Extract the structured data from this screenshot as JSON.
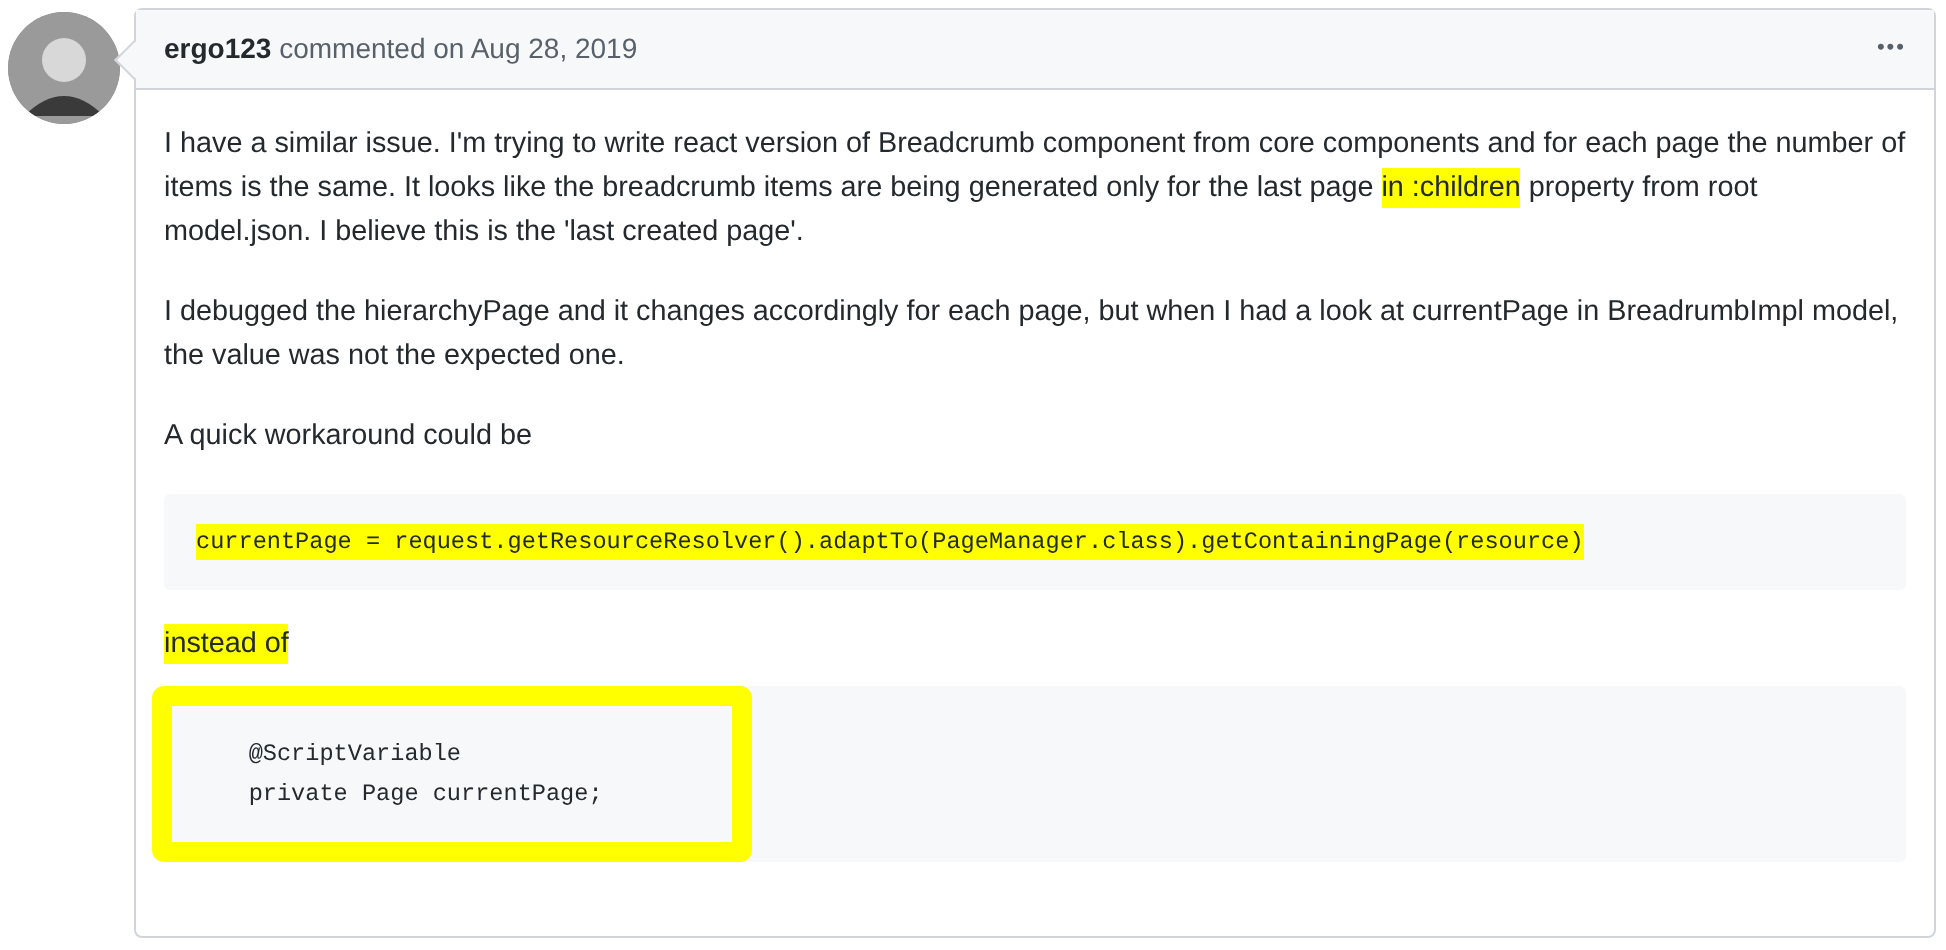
{
  "comment": {
    "author": "ergo123",
    "meta": "commented on Aug 28, 2019",
    "menu": "•••",
    "blocks": [
      {
        "kind": "paragraph",
        "segments": [
          {
            "text": "I have a similar issue. I'm trying to write react version of Breadcrumb component from core components and for each page the number of items is the same. It looks like the breadcrumb items are being generated only for the last page ",
            "highlighted": false
          },
          {
            "text": "in :children",
            "highlighted": true
          },
          {
            "text": " property from root model.json. I believe this is the 'last created page'.",
            "highlighted": false
          }
        ]
      },
      {
        "kind": "paragraph",
        "segments": [
          {
            "text": "I debugged the hierarchyPage and it changes accordingly for each page, but when I had a look at currentPage in BreadrumbImpl model, the value was not the expected one.",
            "highlighted": false
          }
        ]
      },
      {
        "kind": "paragraph",
        "segments": [
          {
            "text": "A quick workaround could be",
            "highlighted": false
          }
        ]
      },
      {
        "kind": "code",
        "circled": false,
        "lines": [
          {
            "text": "currentPage = request.getResourceResolver().adaptTo(PageManager.class).getContainingPage(resource)",
            "highlighted": true
          }
        ]
      },
      {
        "kind": "paragraph",
        "segments": [
          {
            "text": "instead of",
            "highlighted": true
          }
        ]
      },
      {
        "kind": "code",
        "circled": true,
        "lines": [
          {
            "text": "    @ScriptVariable",
            "highlighted": false
          },
          {
            "text": "    private Page currentPage;",
            "highlighted": false
          }
        ]
      }
    ]
  }
}
